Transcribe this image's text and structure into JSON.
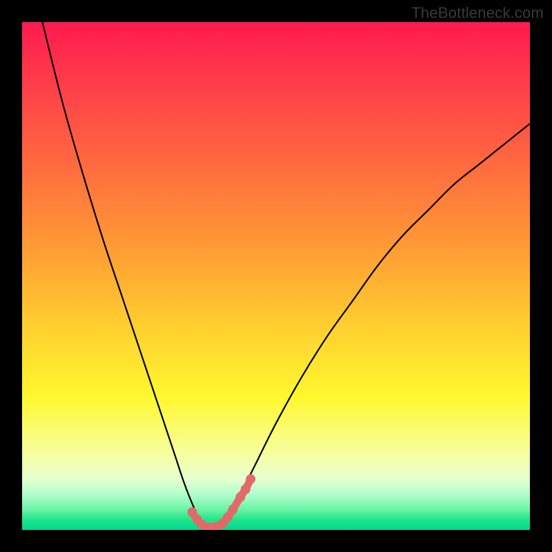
{
  "brand": {
    "label": "TheBottleneck.com"
  },
  "colors": {
    "curve_stroke": "#000000",
    "marker_fill": "#e06a6a",
    "marker_stroke": "#e06a6a"
  },
  "chart_data": {
    "type": "line",
    "title": "",
    "xlabel": "",
    "ylabel": "",
    "xlim": [
      0,
      100
    ],
    "ylim": [
      0,
      100
    ],
    "grid": false,
    "series": [
      {
        "name": "bottleneck-curve",
        "x": [
          4,
          8,
          12,
          16,
          20,
          24,
          26,
          28,
          30,
          32,
          34,
          35,
          36,
          38,
          40,
          42,
          44,
          46,
          50,
          55,
          60,
          65,
          70,
          75,
          80,
          85,
          90,
          95,
          100
        ],
        "y": [
          100,
          84,
          70,
          57,
          45,
          33,
          27,
          21,
          15,
          9,
          4,
          2,
          1,
          1,
          2,
          5,
          9,
          13,
          21,
          30,
          38,
          45,
          52,
          58,
          63,
          68,
          72,
          76,
          80
        ]
      }
    ],
    "markers": {
      "name": "bottom-arc",
      "x": [
        33.5,
        34.5,
        35.5,
        36.5,
        37.5,
        38.5,
        39.5,
        40.5,
        41.5,
        43.0,
        44.0,
        45.0
      ],
      "y": [
        3.5,
        2.0,
        1.0,
        0.5,
        0.5,
        0.7,
        1.3,
        2.5,
        4.0,
        6.5,
        8.0,
        10.0
      ]
    }
  }
}
